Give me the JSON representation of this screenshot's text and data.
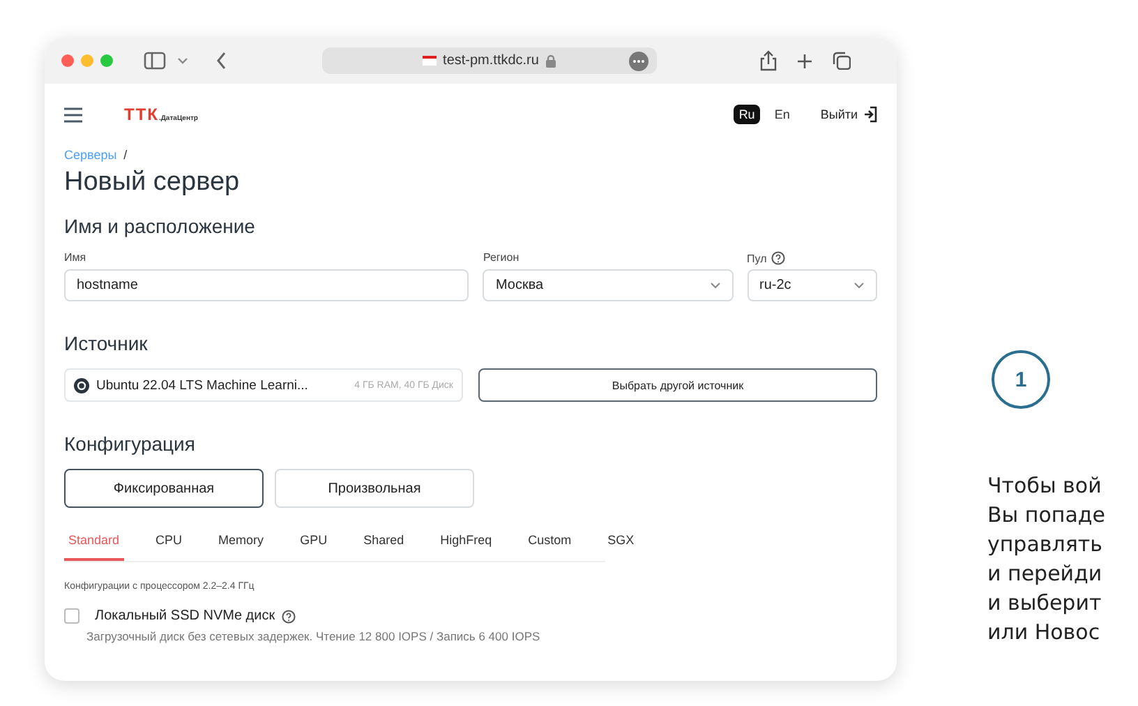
{
  "browser": {
    "url": "test-pm.ttkdc.ru"
  },
  "header": {
    "logo": "ТТК",
    "logo_sub": ".ДатаЦентр",
    "languages": [
      {
        "label": "Ru",
        "selected": true
      },
      {
        "label": "En",
        "selected": false
      }
    ],
    "logout": "Выйти"
  },
  "breadcrumb": {
    "link": "Серверы",
    "separator": "/"
  },
  "title": "Новый сервер",
  "location": {
    "heading": "Имя и расположение",
    "name_label": "Имя",
    "name_value": "hostname",
    "region_label": "Регион",
    "region_value": "Москва",
    "pool_label": "Пул",
    "pool_value": "ru-2c"
  },
  "source": {
    "heading": "Источник",
    "image": "Ubuntu 22.04 LTS Machine Learni...",
    "specs": "4 ГБ RAM, 40 ГБ Диск",
    "button": "Выбрать другой источник"
  },
  "configuration": {
    "heading": "Конфигурация",
    "modes": [
      {
        "label": "Фиксированная",
        "selected": true
      },
      {
        "label": "Произвольная",
        "selected": false
      }
    ],
    "tabs": [
      {
        "label": "Standard",
        "selected": true
      },
      {
        "label": "CPU",
        "selected": false
      },
      {
        "label": "Memory",
        "selected": false
      },
      {
        "label": "GPU",
        "selected": false
      },
      {
        "label": "Shared",
        "selected": false
      },
      {
        "label": "HighFreq",
        "selected": false
      },
      {
        "label": "Custom",
        "selected": false
      },
      {
        "label": "SGX",
        "selected": false
      }
    ],
    "note": "Конфигурации с процессором 2.2–2.4 ГГц",
    "disk": {
      "label": "Локальный SSD NVMe диск",
      "checked": false,
      "description": "Загрузочный диск без сетевых задержек. Чтение 12 800 IOPS / Запись 6 400 IOPS"
    }
  },
  "step": {
    "number": "1",
    "lines": [
      "Чтобы вой",
      "Вы попаде",
      "управлять",
      "и перейди",
      "и выберит",
      "или Новос"
    ]
  }
}
